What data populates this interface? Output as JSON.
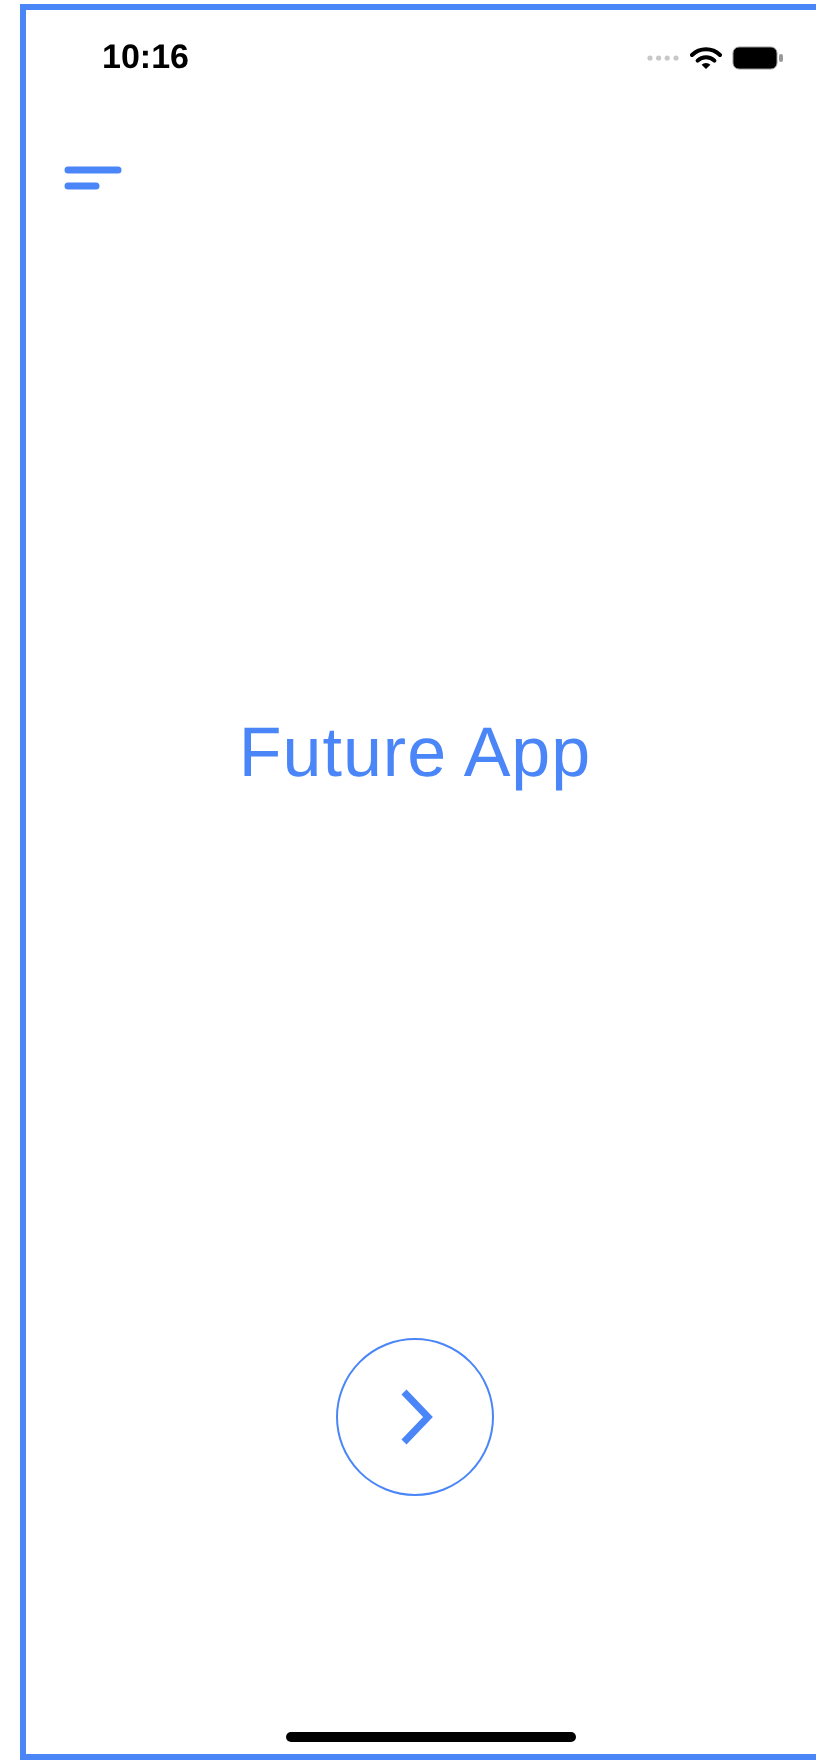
{
  "status_bar": {
    "time": "10:16"
  },
  "title": "Future App"
}
